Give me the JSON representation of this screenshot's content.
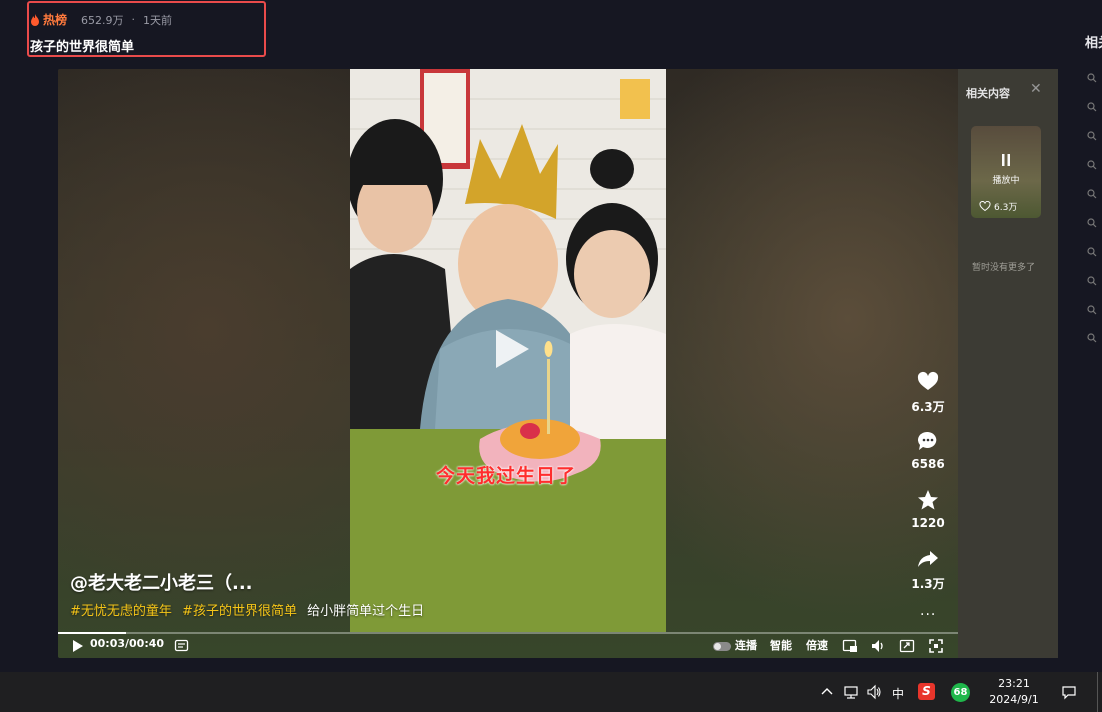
{
  "header": {
    "hot_label": "热榜",
    "hot_count": "652.9万",
    "separator": "·",
    "time_ago": "1天前",
    "title": "孩子的世界很简单"
  },
  "right_sidebar": {
    "title": "相关"
  },
  "video": {
    "overlay_caption": "今天我过生日了",
    "author": "@老大老二小老三（...",
    "tags": [
      "#无忧无虑的童年",
      "#孩子的世界很简单"
    ],
    "description": "给小胖简单过个生日",
    "progress": 0.075
  },
  "actions": {
    "likes": "6.3万",
    "comments": "6586",
    "favorites": "1220",
    "shares": "1.3万",
    "more": "..."
  },
  "controls": {
    "time": "00:03/00:40",
    "autoplay_label": "连播",
    "smart_label": "智能",
    "speed_label": "倍速"
  },
  "related": {
    "title": "相关内容",
    "close": "✕",
    "playing_label": "播放中",
    "likes": "6.3万",
    "no_more": "暂时没有更多了"
  },
  "taskbar": {
    "ime": "中",
    "sogou": "S",
    "badge": "68",
    "time": "23:21",
    "date": "2024/9/1"
  },
  "colors": {
    "hot": "#ff7a3d",
    "tag": "#f5c518",
    "caption": "#ff2d2d",
    "highlight_box": "#e94b4b"
  }
}
